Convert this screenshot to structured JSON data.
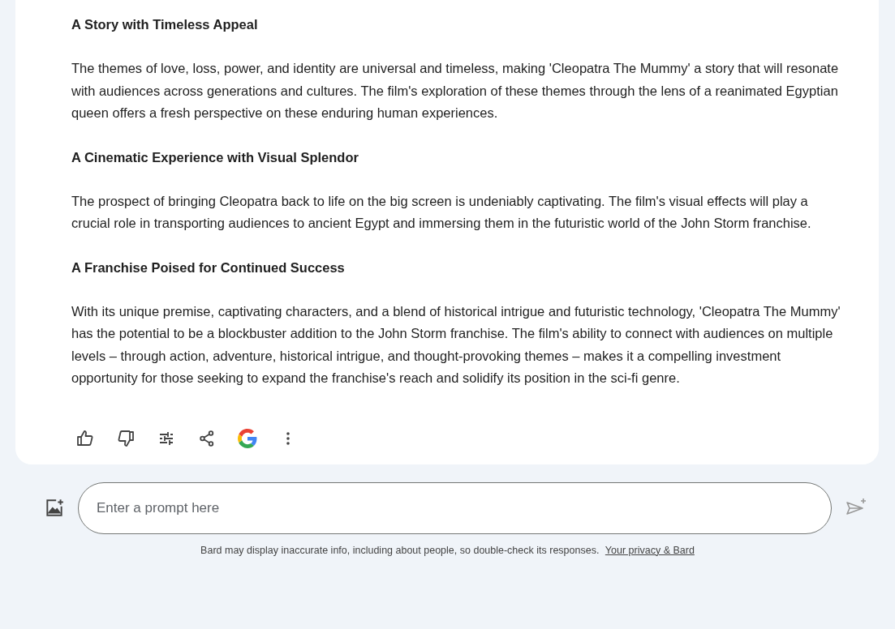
{
  "response": {
    "sections": [
      {
        "heading": "A Story with Timeless Appeal",
        "body": "The themes of love, loss, power, and identity are universal and timeless, making 'Cleopatra The Mummy' a story that will resonate with audiences across generations and cultures. The film's exploration of these themes through the lens of a reanimated Egyptian queen offers a fresh perspective on these enduring human experiences."
      },
      {
        "heading": "A Cinematic Experience with Visual Splendor",
        "body": "The prospect of bringing Cleopatra back to life on the big screen is undeniably captivating. The film's visual effects will play a crucial role in transporting audiences to ancient Egypt and immersing them in the futuristic world of the John Storm franchise."
      },
      {
        "heading": "A Franchise Poised for Continued Success",
        "body": "With its unique premise, captivating characters, and a blend of historical intrigue and futuristic technology, 'Cleopatra The Mummy' has the potential to be a blockbuster addition to the John Storm franchise. The film's ability to connect with audiences on multiple levels – through action, adventure, historical intrigue, and thought-provoking themes – makes it a compelling investment opportunity for those seeking to expand the franchise's reach and solidify its position in the sci-fi genre."
      }
    ]
  },
  "prompt": {
    "placeholder": "Enter a prompt here"
  },
  "footer": {
    "text": "Bard may display inaccurate info, including about people, so double-check its responses.",
    "link": "Your privacy & Bard"
  }
}
